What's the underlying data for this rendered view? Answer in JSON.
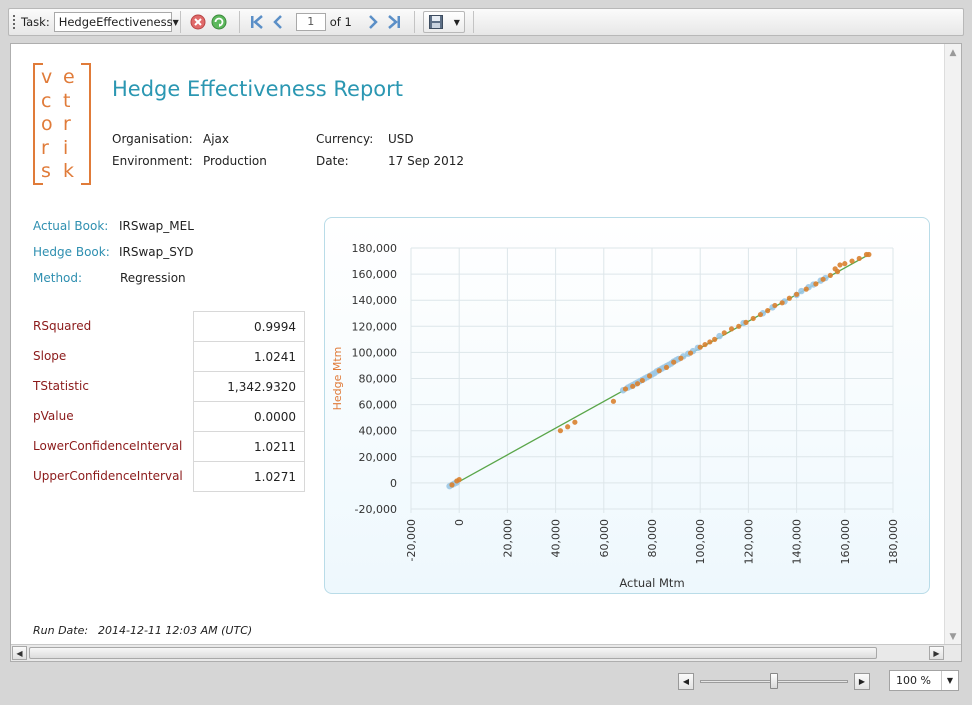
{
  "toolbar": {
    "task_label": "Task:",
    "task_value": "HedgeEffectiveness",
    "page_number": "1",
    "page_of": "of 1"
  },
  "logo": {
    "letters": [
      "v",
      "e",
      "c",
      "t",
      "o",
      "r",
      "r",
      "i",
      "s",
      "k"
    ]
  },
  "report": {
    "title": "Hedge Effectiveness Report",
    "organisation_label": "Organisation:",
    "organisation_value": "Ajax",
    "environment_label": "Environment:",
    "environment_value": "Production",
    "currency_label": "Currency:",
    "currency_value": "USD",
    "date_label": "Date:",
    "date_value": "17 Sep 2012",
    "actual_book_label": "Actual Book:",
    "actual_book_value": "IRSwap_MEL",
    "hedge_book_label": "Hedge Book:",
    "hedge_book_value": "IRSwap_SYD",
    "method_label": "Method:",
    "method_value": "Regression",
    "stats": [
      {
        "name": "RSquared",
        "value": "0.9994"
      },
      {
        "name": "Slope",
        "value": "1.0241"
      },
      {
        "name": "TStatistic",
        "value": "1,342.9320"
      },
      {
        "name": "pValue",
        "value": "0.0000"
      },
      {
        "name": "LowerConfidenceInterval",
        "value": "1.0211"
      },
      {
        "name": "UpperConfidenceInterval",
        "value": "1.0271"
      }
    ],
    "run_date_label": "Run Date:",
    "run_date_value": "2014-12-11 12:03 AM (UTC)"
  },
  "zoom": {
    "value": "100 %",
    "level": 0.5
  },
  "colors": {
    "accent": "#2b97b2",
    "logo": "#e07b39",
    "stat_name": "#8b1a1a",
    "point_blue": "#9cc8e6",
    "point_orange": "#d9812f",
    "fit_line": "#5aa64a"
  },
  "chart_data": {
    "type": "scatter",
    "xlabel": "Actual Mtm",
    "ylabel": "Hedge Mtm",
    "xlim": [
      -20000,
      180000
    ],
    "ylim": [
      -20000,
      180000
    ],
    "xticks": [
      -20000,
      0,
      20000,
      40000,
      60000,
      80000,
      100000,
      120000,
      140000,
      160000,
      180000
    ],
    "yticks": [
      -20000,
      0,
      20000,
      40000,
      60000,
      80000,
      100000,
      120000,
      140000,
      160000,
      180000
    ],
    "xtick_labels": [
      "-20,000",
      "0",
      "20,000",
      "40,000",
      "60,000",
      "80,000",
      "100,000",
      "120,000",
      "140,000",
      "160,000",
      "180,000"
    ],
    "ytick_labels": [
      "-20,000",
      "0",
      "20,000",
      "40,000",
      "60,000",
      "80,000",
      "100,000",
      "120,000",
      "140,000",
      "160,000",
      "180,000"
    ],
    "grid": true,
    "fit_line": {
      "x": [
        0,
        170000
      ],
      "y": [
        1000,
        175000
      ]
    },
    "series": [
      {
        "color": "blue",
        "points": [
          [
            -4000,
            -2500
          ],
          [
            -3000,
            -1500
          ],
          [
            -2000,
            -500
          ],
          [
            -1000,
            300
          ],
          [
            68000,
            71000
          ],
          [
            70000,
            73000
          ],
          [
            71000,
            74000
          ],
          [
            72000,
            75000
          ],
          [
            73000,
            76000
          ],
          [
            74000,
            77000
          ],
          [
            75000,
            78000
          ],
          [
            76000,
            79000
          ],
          [
            77000,
            80000
          ],
          [
            78000,
            81000
          ],
          [
            79000,
            82000
          ],
          [
            80000,
            83000
          ],
          [
            81000,
            84000
          ],
          [
            82000,
            85500
          ],
          [
            83000,
            86500
          ],
          [
            84000,
            87500
          ],
          [
            85000,
            88500
          ],
          [
            86000,
            89500
          ],
          [
            87000,
            90500
          ],
          [
            88000,
            91500
          ],
          [
            89000,
            93000
          ],
          [
            90000,
            94000
          ],
          [
            91000,
            95000
          ],
          [
            93000,
            97000
          ],
          [
            95000,
            99000
          ],
          [
            97000,
            101000
          ],
          [
            99000,
            103500
          ],
          [
            108000,
            112500
          ],
          [
            118000,
            122500
          ],
          [
            126000,
            130000
          ],
          [
            130000,
            134500
          ],
          [
            135000,
            139000
          ],
          [
            140000,
            144000
          ],
          [
            142000,
            147000
          ],
          [
            145000,
            150000
          ],
          [
            147000,
            152000
          ],
          [
            150000,
            155000
          ],
          [
            152000,
            157000
          ]
        ]
      },
      {
        "color": "orange",
        "points": [
          [
            -3000,
            -1500
          ],
          [
            -1000,
            1500
          ],
          [
            0,
            2500
          ],
          [
            42000,
            40000
          ],
          [
            45000,
            43000
          ],
          [
            48000,
            46500
          ],
          [
            64000,
            62500
          ],
          [
            69000,
            72000
          ],
          [
            72000,
            74000
          ],
          [
            74000,
            76000
          ],
          [
            76000,
            78500
          ],
          [
            79000,
            82000
          ],
          [
            83000,
            86000
          ],
          [
            86000,
            88500
          ],
          [
            89000,
            92500
          ],
          [
            92000,
            95500
          ],
          [
            96000,
            99500
          ],
          [
            100000,
            104000
          ],
          [
            102000,
            106000
          ],
          [
            104000,
            108000
          ],
          [
            106000,
            110000
          ],
          [
            110000,
            115000
          ],
          [
            113000,
            118000
          ],
          [
            116000,
            120000
          ],
          [
            119000,
            123000
          ],
          [
            122000,
            126000
          ],
          [
            125000,
            129000
          ],
          [
            128000,
            132000
          ],
          [
            131000,
            136000
          ],
          [
            134000,
            138000
          ],
          [
            137000,
            141500
          ],
          [
            140000,
            144500
          ],
          [
            144000,
            148500
          ],
          [
            148000,
            152500
          ],
          [
            151000,
            156000
          ],
          [
            154000,
            159000
          ],
          [
            157000,
            162000
          ],
          [
            156000,
            164000
          ],
          [
            158000,
            167000
          ],
          [
            160000,
            168000
          ],
          [
            163000,
            170000
          ],
          [
            166000,
            172000
          ],
          [
            169000,
            175000
          ],
          [
            170000,
            175000
          ]
        ]
      }
    ]
  }
}
